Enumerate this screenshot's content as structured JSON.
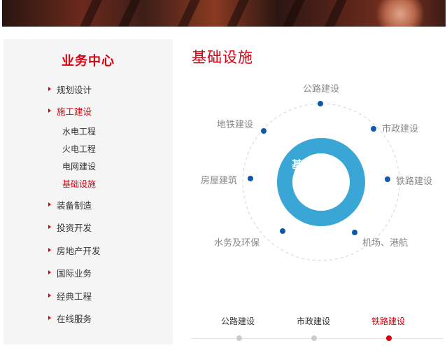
{
  "sidebar": {
    "title": "业务中心",
    "items": [
      {
        "label": "规划设计"
      },
      {
        "label": "施工建设"
      },
      {
        "label": "装备制造"
      },
      {
        "label": "投资开发"
      },
      {
        "label": "房地产开发"
      },
      {
        "label": "国际业务"
      },
      {
        "label": "经典工程"
      },
      {
        "label": "在线服务"
      }
    ],
    "sub_items": [
      {
        "label": "水电工程"
      },
      {
        "label": "火电工程"
      },
      {
        "label": "电网建设"
      },
      {
        "label": "基础设施"
      }
    ],
    "active_item": "施工建设",
    "active_sub_item": "基础设施"
  },
  "main": {
    "title": "基础设施",
    "center_line1": "基础设施",
    "center_line2": "建设",
    "nodes": [
      {
        "label": "公路建设"
      },
      {
        "label": "市政建设"
      },
      {
        "label": "铁路建设"
      },
      {
        "label": "机场、港航"
      },
      {
        "label": "水务及环保"
      },
      {
        "label": "房屋建筑"
      },
      {
        "label": "地铁建设"
      }
    ],
    "tabs": [
      {
        "label": "公路建设"
      },
      {
        "label": "市政建设"
      },
      {
        "label": "铁路建设"
      }
    ],
    "active_tab": "铁路建设"
  },
  "colors": {
    "accent": "#d7000f",
    "ring": "#3aa6d6",
    "node_dot": "#0f5aa8"
  }
}
